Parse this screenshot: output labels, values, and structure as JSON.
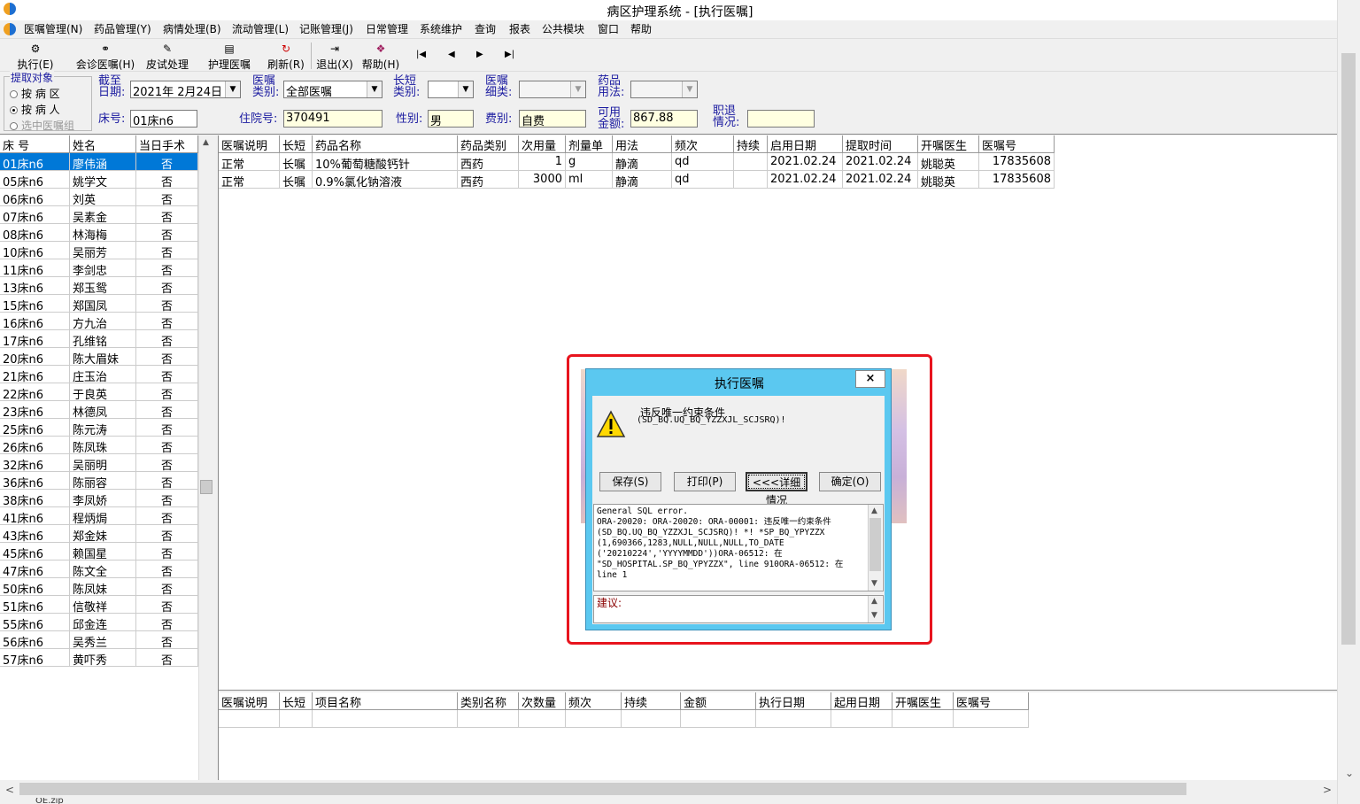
{
  "window": {
    "title": "病区护理系统 - [执行医嘱]"
  },
  "menu": [
    "医嘱管理(N)",
    "药品管理(Y)",
    "病情处理(B)",
    "流动管理(L)",
    "记账管理(J)",
    "日常管理",
    "系统维护",
    "查询",
    "报表",
    "公共模块",
    "窗口",
    "帮助"
  ],
  "toolbar": {
    "execute": "执行(E)",
    "consult": "会诊医嘱(H)",
    "skintest": "皮试处理",
    "nursing": "护理医嘱",
    "refresh": "刷新(R)",
    "exit": "退出(X)",
    "help": "帮助(H)"
  },
  "filters": {
    "extract_group_label": "提取对象",
    "by_ward": "按 病 区",
    "by_patient": "按 病 人",
    "selected_group": "选中医嘱组",
    "date_label_1": "截至",
    "date_label_2": "日期:",
    "date_value": "2021年  2月24日",
    "order_type_label_1": "医嘱",
    "order_type_label_2": "类别:",
    "order_type_value": "全部医嘱",
    "long_short_label_1": "长短",
    "long_short_label_2": "类别:",
    "detail_label_1": "医嘱",
    "detail_label_2": "细类:",
    "usage_label_1": "药品",
    "usage_label_2": "用法:",
    "bed_label": "床号:",
    "bed_value": "01床n6",
    "admission_label": "住院号:",
    "admission_value": "370491",
    "sex_label": "性别:",
    "sex_value": "男",
    "fee_label": "费别:",
    "fee_value": "自费",
    "balance_label_1": "可用",
    "balance_label_2": "金额:",
    "balance_value": "867.88",
    "discharge_label_1": "职退",
    "discharge_label_2": "情况:"
  },
  "patients": {
    "headers": [
      "床 号",
      "姓名",
      "当日手术"
    ],
    "rows": [
      [
        "01床n6",
        "廖伟涵",
        "否"
      ],
      [
        "05床n6",
        "姚学文",
        "否"
      ],
      [
        "06床n6",
        "刘英",
        "否"
      ],
      [
        "07床n6",
        "吴素金",
        "否"
      ],
      [
        "08床n6",
        "林海梅",
        "否"
      ],
      [
        "10床n6",
        "吴丽芳",
        "否"
      ],
      [
        "11床n6",
        "李剑忠",
        "否"
      ],
      [
        "13床n6",
        "郑玉鸳",
        "否"
      ],
      [
        "15床n6",
        "郑国凤",
        "否"
      ],
      [
        "16床n6",
        "方九治",
        "否"
      ],
      [
        "17床n6",
        "孔维铭",
        "否"
      ],
      [
        "20床n6",
        "陈大眉妹",
        "否"
      ],
      [
        "21床n6",
        "庄玉治",
        "否"
      ],
      [
        "22床n6",
        "于良英",
        "否"
      ],
      [
        "23床n6",
        "林德凤",
        "否"
      ],
      [
        "25床n6",
        "陈元涛",
        "否"
      ],
      [
        "26床n6",
        "陈凤珠",
        "否"
      ],
      [
        "32床n6",
        "吴丽明",
        "否"
      ],
      [
        "36床n6",
        "陈丽容",
        "否"
      ],
      [
        "38床n6",
        "李凤娇",
        "否"
      ],
      [
        "41床n6",
        "程炳焗",
        "否"
      ],
      [
        "43床n6",
        "郑金妹",
        "否"
      ],
      [
        "45床n6",
        "赖国星",
        "否"
      ],
      [
        "47床n6",
        "陈文全",
        "否"
      ],
      [
        "50床n6",
        "陈凤妹",
        "否"
      ],
      [
        "51床n6",
        "信敬祥",
        "否"
      ],
      [
        "55床n6",
        "邱金连",
        "否"
      ],
      [
        "56床n6",
        "吴秀兰",
        "否"
      ],
      [
        "57床n6",
        "黄吓秀",
        "否"
      ]
    ]
  },
  "orders": {
    "headers": [
      "医嘱说明",
      "长短",
      "药品名称",
      "药品类别",
      "次用量",
      "剂量单",
      "用法",
      "频次",
      "持续",
      "启用日期",
      "提取时间",
      "开嘱医生",
      "医嘱号"
    ],
    "rows": [
      [
        "正常",
        "长嘱",
        "10%葡萄糖酸钙针",
        "西药",
        "1",
        "g",
        "静滴",
        "qd",
        "",
        "2021.02.24",
        "2021.02.24",
        "姚聪英",
        "17835608"
      ],
      [
        "正常",
        "长嘱",
        "0.9%氯化钠溶液",
        "西药",
        "3000",
        "ml",
        "静滴",
        "qd",
        "",
        "2021.02.24",
        "2021.02.24",
        "姚聪英",
        "17835608"
      ]
    ]
  },
  "items": {
    "headers": [
      "医嘱说明",
      "长短",
      "项目名称",
      "类别名称",
      "次数量",
      "频次",
      "持续",
      "金额",
      "执行日期",
      "起用日期",
      "开嘱医生",
      "医嘱号"
    ]
  },
  "dialog": {
    "title": "执行医嘱",
    "close": "×",
    "message_1": "违反唯一约束条件",
    "message_2": "(SD_BQ.UQ_BQ_YZZXJL_SCJSRQ)!",
    "save": "保存(S)",
    "print": "打印(P)",
    "details": "<<<详细情况",
    "ok": "确定(O)",
    "detail_text": "General SQL error.\nORA-20020: ORA-20020: ORA-00001: 违反唯一约束条件\n(SD_BQ.UQ_BQ_YZZXJL_SCJSRQ)! *! *SP_BQ_YPYZZX\n(1,690366,1283,NULL,NULL,NULL,TO_DATE\n('20210224','YYYYMMDD'))ORA-06512: 在\n\"SD_HOSPITAL.SP_BQ_YPYZZX\", line 910ORA-06512: 在\nline 1",
    "suggestion_label": "建议:"
  },
  "taskbar_text": "OE.zip"
}
